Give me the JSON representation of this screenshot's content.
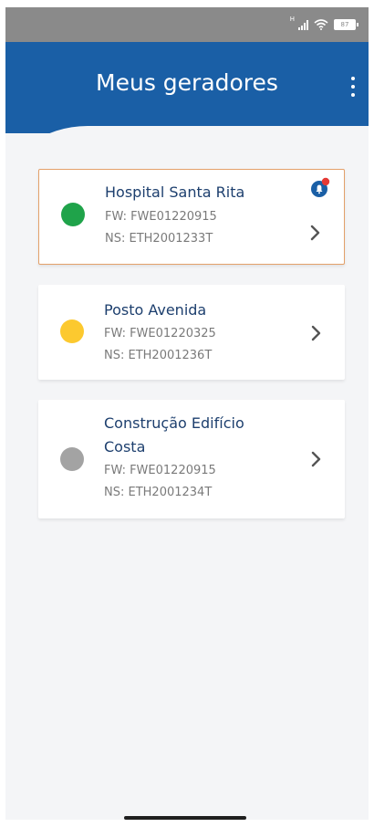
{
  "statusbar": {
    "network_label": "H",
    "battery": "87"
  },
  "header": {
    "title": "Meus geradores"
  },
  "generators": [
    {
      "name": "Hospital Santa Rita",
      "fw": "FW: FWE01220915",
      "ns": "NS: ETH2001233T",
      "status_color": "#1fa34a",
      "has_alert": true
    },
    {
      "name": "Posto Avenida",
      "fw": "FW: FWE01220325",
      "ns": "NS: ETH2001236T",
      "status_color": "#fcc92f",
      "has_alert": false
    },
    {
      "name": "Construção Edifício Costa",
      "fw": "FW: FWE01220915",
      "ns": "NS: ETH2001234T",
      "status_color": "#a3a3a3",
      "has_alert": false
    }
  ],
  "colors": {
    "primary": "#1a5fa6",
    "title_text": "#1d3f6e",
    "alert_badge": "#e53935",
    "selected_border": "#e3a06a"
  },
  "icons": {
    "menu": "more-vert-icon",
    "alert": "notification-bell-icon",
    "chevron": "chevron-right-icon"
  }
}
